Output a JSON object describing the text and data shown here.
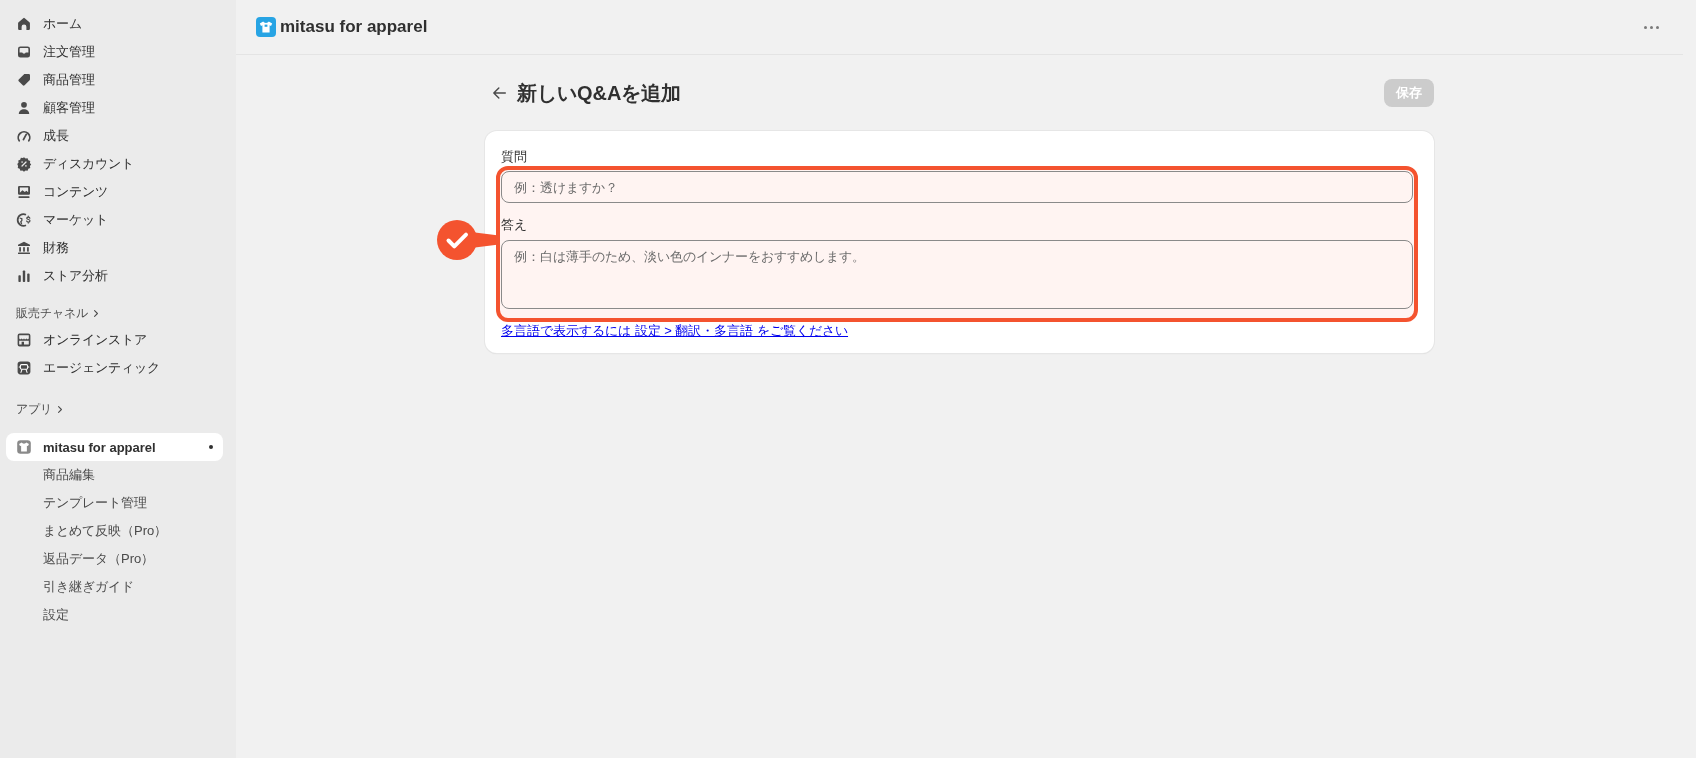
{
  "sidebar": {
    "nav": [
      {
        "label": "ホーム",
        "selected": false
      },
      {
        "label": "注文管理",
        "selected": false
      },
      {
        "label": "商品管理",
        "selected": false
      },
      {
        "label": "顧客管理",
        "selected": false
      },
      {
        "label": "成長",
        "selected": false
      },
      {
        "label": "ディスカウント",
        "selected": false
      },
      {
        "label": "コンテンツ",
        "selected": false
      },
      {
        "label": "マーケット",
        "selected": false
      },
      {
        "label": "財務",
        "selected": false
      },
      {
        "label": "ストア分析",
        "selected": false
      }
    ],
    "sales_channels": {
      "title": "販売チャネル",
      "items": [
        {
          "label": "オンラインストア",
          "selected": false
        },
        {
          "label": "エージェンティック",
          "selected": false
        }
      ]
    },
    "apps": {
      "title": "アプリ",
      "items": [
        {
          "label": "mitasu for apparel",
          "selected": true,
          "children": [
            {
              "label": "商品編集",
              "selected": false
            },
            {
              "label": "テンプレート管理",
              "selected": false
            },
            {
              "label": "まとめて反映（Pro）",
              "selected": false
            },
            {
              "label": "返品データ（Pro）",
              "selected": false
            },
            {
              "label": "引き継ぎガイド",
              "selected": false
            },
            {
              "label": "設定",
              "selected": false
            }
          ]
        }
      ]
    }
  },
  "header": {
    "app_name": "mitasu for apparel"
  },
  "page": {
    "title": "新しいQ&Aを追加",
    "save_button": {
      "label": "保存",
      "disabled": true
    }
  },
  "form": {
    "highlighted": true,
    "fields": [
      {
        "kind": "input",
        "label": "質問",
        "placeholder": "例：透けますか？"
      },
      {
        "kind": "textarea",
        "label": "答え",
        "placeholder": "例：白は薄手のため、淡い色のインナーをおすすめします。"
      }
    ],
    "help_link": "多言語で表示するには 設定 > 翻訳・多言語 をご覧ください"
  }
}
